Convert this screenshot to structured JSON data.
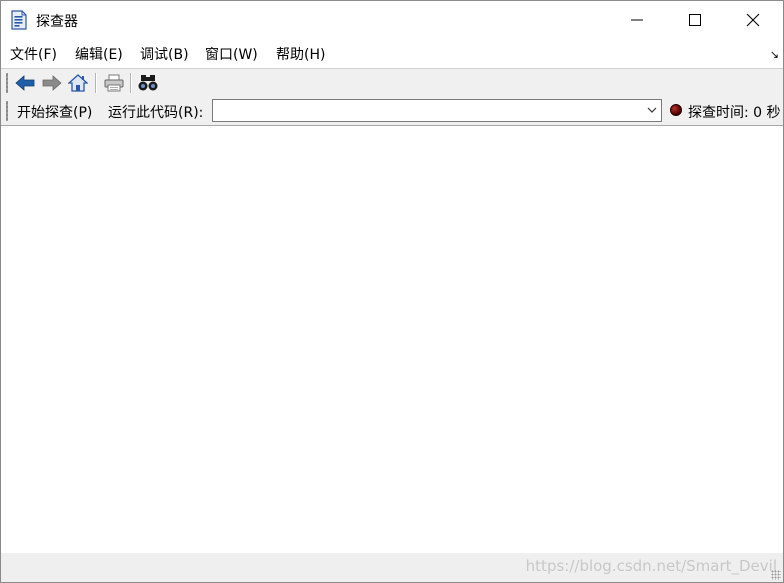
{
  "window": {
    "title": "探查器",
    "controls": {
      "minimize": "minimize",
      "maximize": "maximize",
      "close": "close"
    }
  },
  "menu": {
    "items": [
      {
        "label": "文件(F)"
      },
      {
        "label": "编辑(E)"
      },
      {
        "label": "调试(B)"
      },
      {
        "label": "窗口(W)"
      },
      {
        "label": "帮助(H)"
      }
    ],
    "corner_glyph": "↘"
  },
  "toolbar": {
    "icons": [
      "back-arrow-icon",
      "forward-arrow-icon",
      "home-icon",
      "printer-icon",
      "binoculars-icon"
    ],
    "colors": {
      "back": "#1f5fa8",
      "forward": "#8a8a8a",
      "home": "#2b57a6"
    }
  },
  "probebar": {
    "start_label": "开始探查(P)",
    "run_code_label": "运行此代码(R):",
    "code_value": "",
    "probe_time_label": "探查时间: 0 秒",
    "status_color": "#5a0000"
  },
  "statusbar": {
    "watermark": "https://blog.csdn.net/Smart_Devil"
  }
}
